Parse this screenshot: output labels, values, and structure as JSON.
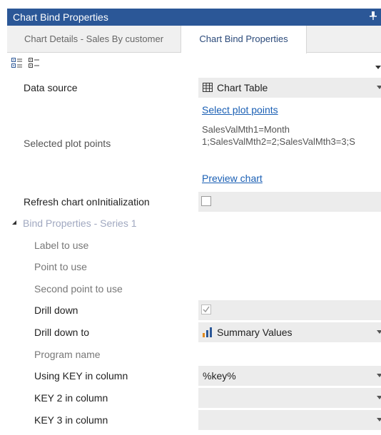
{
  "panel": {
    "title": "Chart Bind Properties",
    "pin_glyph": "⊥"
  },
  "tabs": [
    {
      "label": "Chart Details - Sales By customer",
      "active": false
    },
    {
      "label": "Chart Bind Properties",
      "active": true
    }
  ],
  "toolbar": {
    "icons": [
      "categorized-icon",
      "alphabetical-icon"
    ]
  },
  "properties": {
    "data_source": {
      "label": "Data source",
      "value": "Chart Table",
      "icon": "table-icon"
    },
    "select_plot_points_link": "Select plot points",
    "selected_plot_points": {
      "label": "Selected plot points",
      "line1": "SalesValMth1=Month",
      "line2": "1;SalesValMth2=2;SalesValMth3=3;S"
    },
    "preview_chart_link": "Preview chart",
    "refresh_chart": {
      "label": "Refresh chart onInitialization",
      "checked": false
    }
  },
  "group": {
    "label": "Bind Properties - Series 1",
    "items": {
      "label_to_use": "Label to use",
      "point_to_use": "Point to use",
      "second_point": "Second point to use",
      "drill_down": {
        "label": "Drill down",
        "checked": true
      },
      "drill_down_to": {
        "label": "Drill down to",
        "value": "Summary Values",
        "icon": "bar-chart-icon"
      },
      "program_name": "Program name",
      "using_key": {
        "label": "Using KEY in column",
        "value": "%key%"
      },
      "key2": {
        "label": "KEY 2 in column",
        "value": ""
      },
      "key3": {
        "label": "KEY 3 in column",
        "value": ""
      }
    }
  },
  "colors": {
    "titlebar": "#2b5797",
    "link": "#1a5fb4",
    "value_bg": "#ececec",
    "group_label": "#a0a8c0"
  }
}
